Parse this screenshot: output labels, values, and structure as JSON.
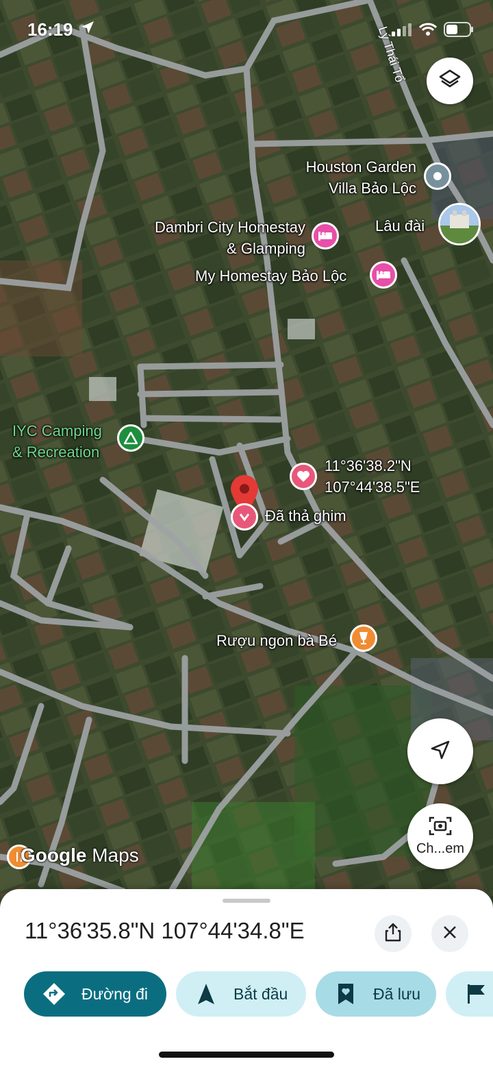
{
  "status_bar": {
    "time": "16:19",
    "location_icon": "location-arrow-icon",
    "signal_icon": "cellular-signal-icon",
    "wifi_icon": "wifi-icon",
    "battery_icon": "battery-icon"
  },
  "map": {
    "street_label": "Lý Thái Tổ",
    "places": {
      "houston_garden": {
        "name_line1": "Houston Garden",
        "name_line2": "Villa Bảo Lộc",
        "icon": "place-dot-icon"
      },
      "lau_dai": {
        "name": "Lâu đài",
        "icon": "photo-thumbnail-icon"
      },
      "dambri": {
        "name_line1": "Dambri City Homestay",
        "name_line2": "& Glamping",
        "icon": "hotel-bed-icon",
        "color": "#e84fa8"
      },
      "my_homestay": {
        "name": "My Homestay Bảo Lộc",
        "icon": "hotel-bed-icon",
        "color": "#e84fa8"
      },
      "iyc_camping": {
        "name_line1": "IYC Camping",
        "name_line2": "& Recreation",
        "icon": "campground-icon",
        "color": "#1e8e3e"
      },
      "favorite_coords": {
        "line1": "11°36'38.2\"N",
        "line2": "107°44'38.5\"E",
        "icon": "heart-icon",
        "color": "#e8577a"
      },
      "dropped_pin": {
        "name": "Đã thả ghim",
        "icon": "red-map-pin-icon",
        "color": "#e53935"
      },
      "ruou_ngon": {
        "name": "Rượu ngon bà Bé",
        "icon": "wine-glass-icon",
        "color": "#f08c32"
      }
    },
    "logo_google": "Google",
    "logo_maps": "Maps"
  },
  "controls": {
    "layers_icon": "layers-icon",
    "my_location_icon": "navigation-arrow-icon",
    "camera_search_icon": "camera-search-icon",
    "camera_search_label": "Ch...em"
  },
  "bottom_sheet": {
    "coordinates": "11°36'35.8\"N 107°44'34.8\"E",
    "share_icon": "share-icon",
    "close_icon": "close-icon",
    "chips": {
      "directions": {
        "label": "Đường đi",
        "icon": "directions-diamond-icon"
      },
      "start": {
        "label": "Bắt đầu",
        "icon": "navigation-arrow-icon"
      },
      "saved": {
        "label": "Đã lưu",
        "icon": "bookmark-icon"
      },
      "label": {
        "label": "",
        "icon": "flag-icon"
      }
    }
  },
  "colors": {
    "primary_chip": "#0b6e80",
    "secondary_chip": "#cfeff4",
    "saved_chip": "#a7dbe6",
    "pin_red": "#e53935"
  }
}
